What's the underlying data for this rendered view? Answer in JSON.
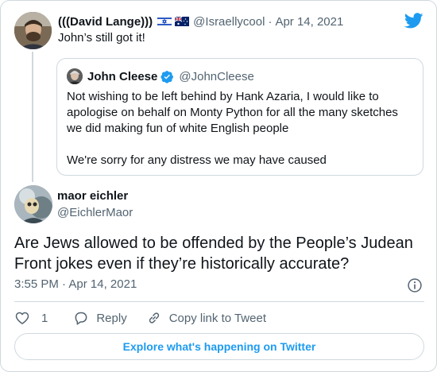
{
  "parent_tweet": {
    "display_name": "(((David Lange)))",
    "flags": [
      "israel-flag",
      "australia-flag"
    ],
    "handle": "@Israellycool",
    "separator": "·",
    "date": "Apr 14, 2021",
    "text": "John’s still got it!"
  },
  "quoted_tweet": {
    "display_name": "John Cleese",
    "verified": true,
    "handle": "@JohnCleese",
    "lines": [
      "Not wishing to be left behind by Hank Azaria, I would like to",
      "apologise on behalf on Monty Python for all the many sketches",
      "we did making fun of white English people"
    ],
    "second_paragraph": "We're sorry for any distress we may have caused"
  },
  "main_tweet": {
    "display_name": "maor eichler",
    "handle": "@EichlerMaor",
    "text_lines": [
      "Are Jews allowed to be offended by the People’s Judean",
      "Front jokes even if they’re historically accurate?"
    ],
    "time": "3:55 PM",
    "separator": "·",
    "date": "Apr 14, 2021"
  },
  "actions": {
    "like_count": "1",
    "reply_label": "Reply",
    "copy_link_label": "Copy link to Tweet"
  },
  "explore_button": "Explore what's happening on Twitter",
  "colors": {
    "accent": "#1d9bf0",
    "text": "#0f1419",
    "muted": "#536471",
    "border": "#cfd9de"
  },
  "icons": [
    "twitter-bird-icon",
    "verified-badge-icon",
    "info-icon",
    "heart-icon",
    "reply-icon",
    "link-icon"
  ]
}
